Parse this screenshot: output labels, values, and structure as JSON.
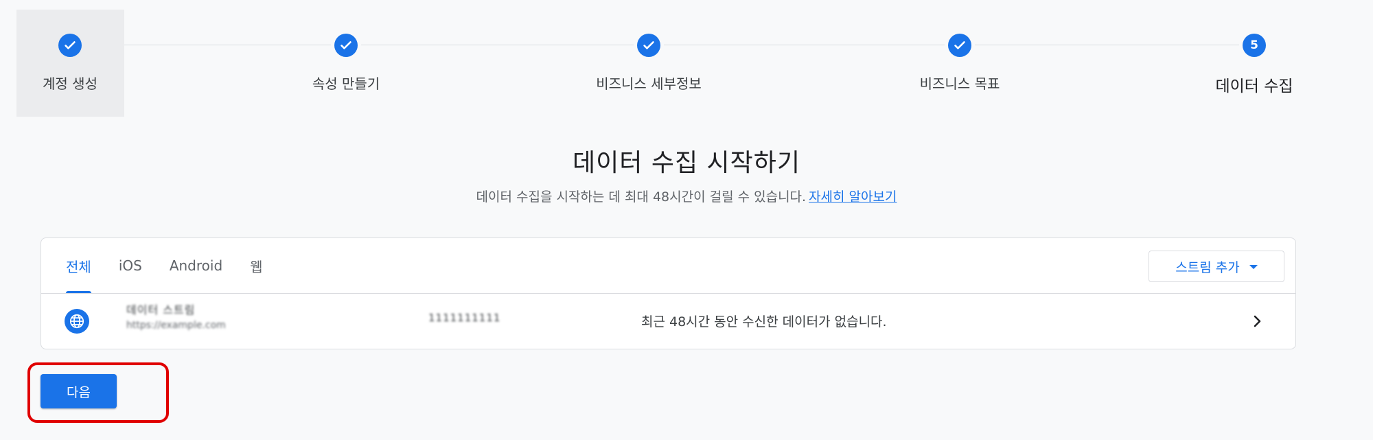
{
  "stepper": {
    "steps": [
      {
        "label": "계정 생성",
        "state": "done"
      },
      {
        "label": "속성 만들기",
        "state": "done"
      },
      {
        "label": "비즈니스 세부정보",
        "state": "done"
      },
      {
        "label": "비즈니스 목표",
        "state": "done"
      },
      {
        "label": "데이터 수집",
        "state": "current",
        "number": "5"
      }
    ]
  },
  "main": {
    "title": "데이터 수집 시작하기",
    "subtitle": "데이터 수집을 시작하는 데 최대 48시간이 걸릴 수 있습니다.",
    "learn_more": "자세히 알아보기"
  },
  "streams": {
    "tabs": [
      {
        "label": "전체"
      },
      {
        "label": "iOS"
      },
      {
        "label": "Android"
      },
      {
        "label": "웹"
      }
    ],
    "add_stream_label": "스트림 추가",
    "rows": [
      {
        "name": "데이터 스트림",
        "url": "https://example.com",
        "id": "1111111111",
        "status": "최근 48시간 동안 수신한 데이터가 없습니다."
      }
    ]
  },
  "footer": {
    "next_label": "다음"
  },
  "colors": {
    "accent": "#1a73e8",
    "highlight": "#e00000"
  }
}
